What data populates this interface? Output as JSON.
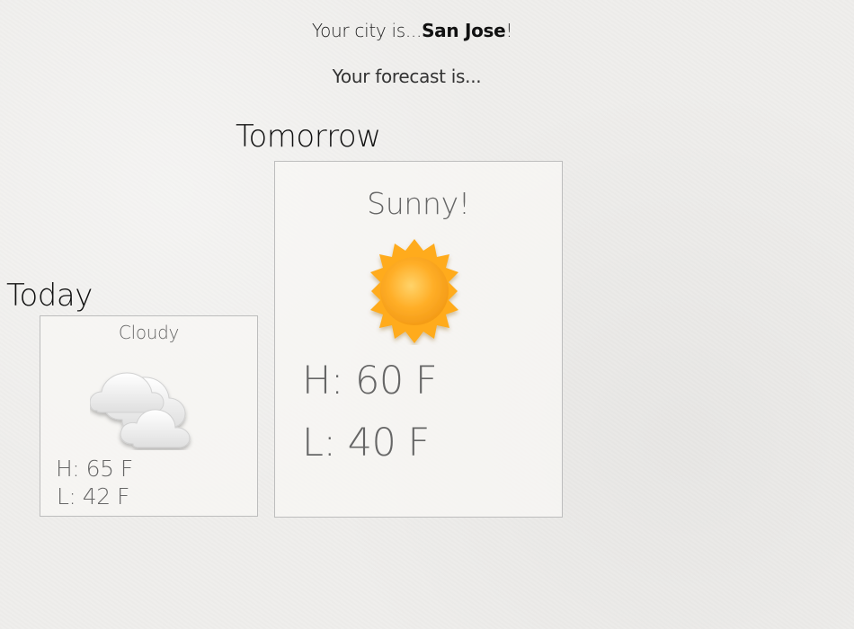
{
  "header": {
    "city_prefix": "Your city is...",
    "city_name": "San Jose",
    "city_suffix": "!",
    "forecast_text": "Your forecast is..."
  },
  "forecast": {
    "tomorrow": {
      "label": "Tomorrow",
      "condition": "Sunny!",
      "high": "H: 60 F",
      "low": "L: 40 F",
      "icon": "sun-icon"
    },
    "today": {
      "label": "Today",
      "condition": "Cloudy",
      "high": "H: 65 F",
      "low": "L: 42 F",
      "icon": "cloud-icon"
    }
  },
  "colors": {
    "background": "#efeeec",
    "card_border": "#bdbdbd",
    "sun_orange": "#f7a321",
    "cloud_white": "#f4f4f4"
  }
}
